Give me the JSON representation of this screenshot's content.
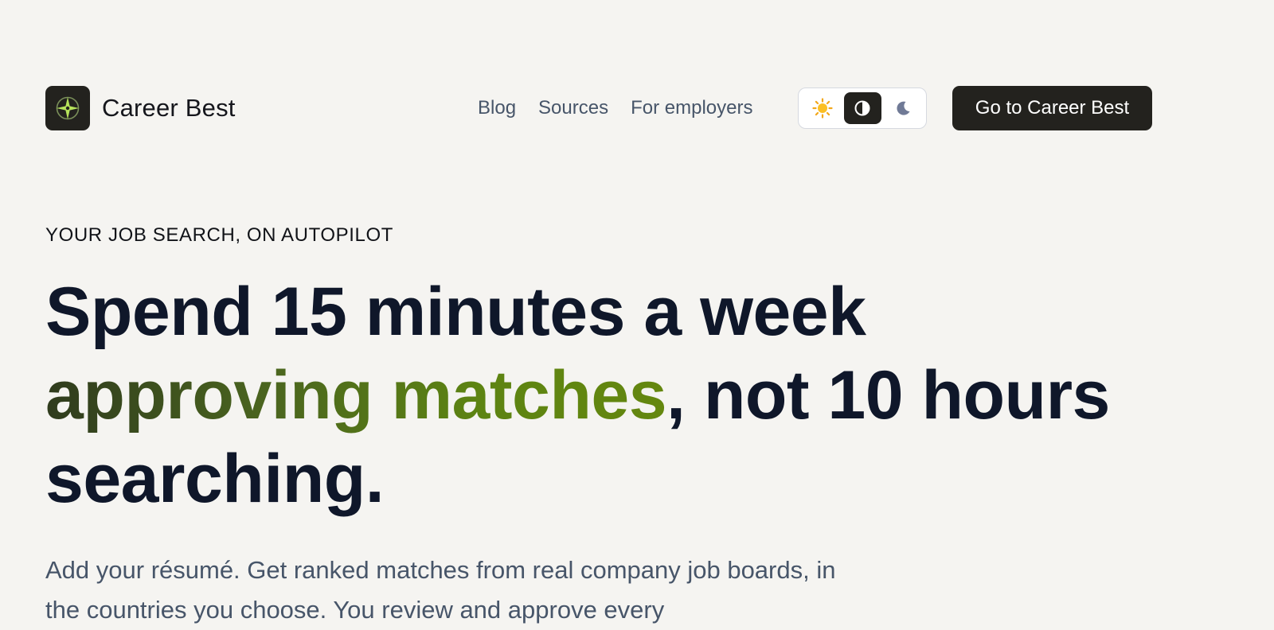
{
  "brand": {
    "name": "Career Best",
    "logo_icon": "compass-star-icon",
    "logo_accent_color": "#b6e35b"
  },
  "nav": {
    "links": [
      "Blog",
      "Sources",
      "For employers"
    ]
  },
  "theme_toggle": {
    "options": [
      {
        "name": "light",
        "icon": "sun-icon",
        "active": false
      },
      {
        "name": "system",
        "icon": "contrast-icon",
        "active": true
      },
      {
        "name": "dark",
        "icon": "moon-icon",
        "active": false
      }
    ]
  },
  "cta": {
    "label": "Go to Career Best"
  },
  "hero": {
    "eyebrow": "YOUR JOB SEARCH, ON AUTOPILOT",
    "headline_line1": "Spend 15 minutes a week",
    "headline_accent": "approving matches",
    "headline_line2_rest": ", not 10 hours",
    "headline_line3": "searching.",
    "lede": "Add your résumé. Get ranked matches from real company job boards, in the countries you choose. You review and approve every"
  },
  "colors": {
    "background": "#f5f4f1",
    "dark": "#23221e",
    "headline": "#0f172a",
    "muted": "#475569",
    "accent_start": "#2f3b1d",
    "accent_end": "#64870f"
  }
}
